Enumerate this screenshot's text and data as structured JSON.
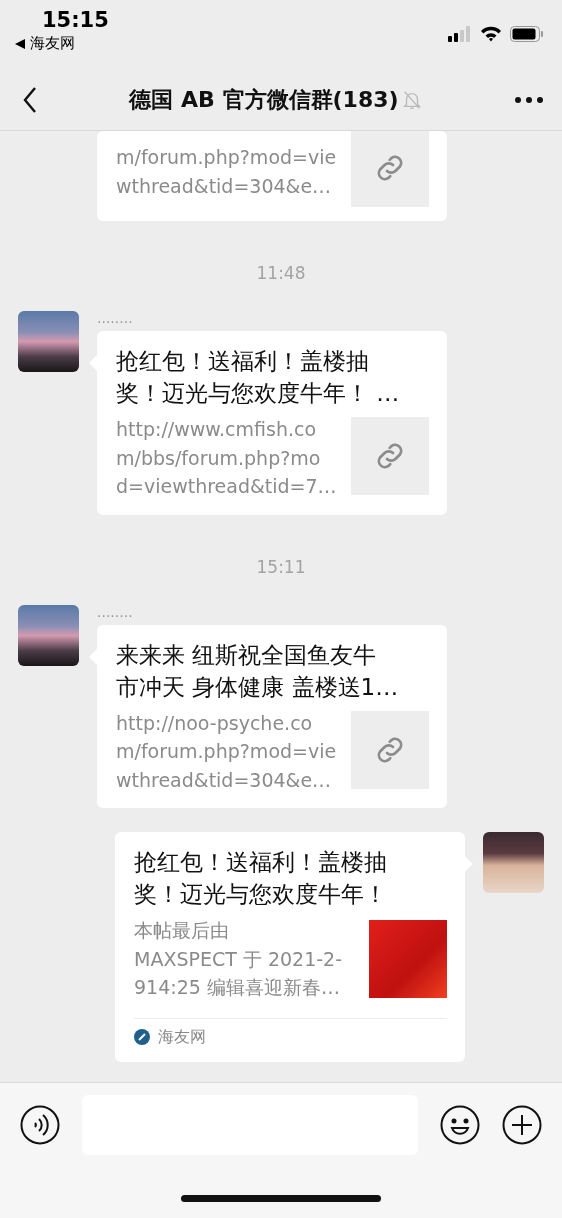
{
  "status_bar": {
    "time": "15:15",
    "back_app": "海友网"
  },
  "nav": {
    "title": "德国 AB  官方微信群(183)",
    "muted": true
  },
  "messages": [
    {
      "kind": "partial_link",
      "desc_lines": [
        "m/forum.php?mod=vie",
        "wthread&tid=304&e…"
      ]
    },
    {
      "kind": "time",
      "text": "11:48"
    },
    {
      "kind": "incoming_link",
      "sender": "........",
      "title_lines": [
        "抢红包！送福利！盖楼抽",
        "奖！迈光与您欢度牛年！ …"
      ],
      "desc_lines": [
        "http://www.cmfish.co",
        "m/bbs/forum.php?mo",
        "d=viewthread&tid=7…"
      ]
    },
    {
      "kind": "time",
      "text": "15:11"
    },
    {
      "kind": "incoming_link",
      "sender": "........",
      "title_lines": [
        "来来来 纽斯祝全国鱼友牛",
        "市冲天 身体健康 盖楼送1…"
      ],
      "desc_lines": [
        "http://noo-psyche.co",
        "m/forum.php?mod=vie",
        "wthread&tid=304&e…"
      ]
    },
    {
      "kind": "outgoing_article",
      "title_lines": [
        "抢红包！送福利！盖楼抽",
        "奖！迈光与您欢度牛年！"
      ],
      "desc_lines": [
        "本帖最后由",
        "MAXSPECT 于 2021-2-",
        "914:25 编辑喜迎新春…"
      ],
      "source": "海友网"
    }
  ]
}
